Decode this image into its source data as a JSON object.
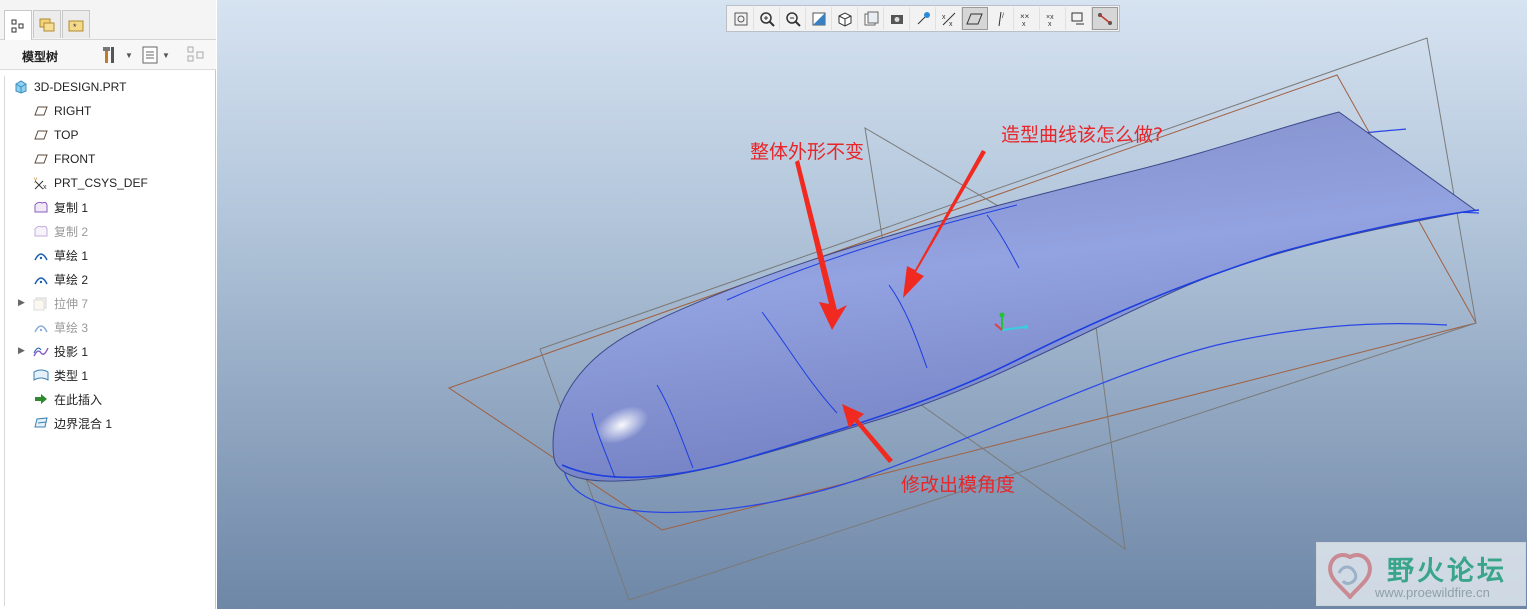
{
  "panel": {
    "title": "模型树",
    "tabs": [
      {
        "name": "model-tree-tab",
        "icon": "model-tree-icon"
      },
      {
        "name": "layers-tab",
        "icon": "folder-stack-icon"
      },
      {
        "name": "favorites-tab",
        "icon": "star-folder-icon"
      }
    ]
  },
  "tree": {
    "root": "3D-DESIGN.PRT",
    "items": [
      {
        "label": "RIGHT",
        "icon": "datum-plane-icon",
        "dim": false
      },
      {
        "label": "TOP",
        "icon": "datum-plane-icon",
        "dim": false
      },
      {
        "label": "FRONT",
        "icon": "datum-plane-icon",
        "dim": false
      },
      {
        "label": "PRT_CSYS_DEF",
        "icon": "coordinate-system-icon",
        "dim": false
      },
      {
        "label": "复制 1",
        "icon": "copy-surface-icon",
        "dim": false
      },
      {
        "label": "复制 2",
        "icon": "copy-surface-icon",
        "dim": true
      },
      {
        "label": "草绘 1",
        "icon": "sketch-icon",
        "dim": false
      },
      {
        "label": "草绘 2",
        "icon": "sketch-icon",
        "dim": false
      },
      {
        "label": "拉伸 7",
        "icon": "extrude-icon",
        "dim": true
      },
      {
        "label": "草绘 3",
        "icon": "sketch-icon",
        "dim": true
      },
      {
        "label": "投影 1",
        "icon": "projection-icon",
        "dim": false
      },
      {
        "label": "类型 1",
        "icon": "style-surface-icon",
        "dim": false
      },
      {
        "label": "在此插入",
        "icon": "insert-here-arrow-icon",
        "dim": false
      },
      {
        "label": "边界混合 1",
        "icon": "boundary-blend-icon",
        "dim": false
      }
    ]
  },
  "toolbar": {
    "buttons": [
      "refit-icon",
      "zoom-in-icon",
      "zoom-out-icon",
      "repaint-icon",
      "saved-orientations-icon",
      "display-style-icon",
      "named-views-icon",
      "spin-center-icon",
      "datum-display-filter-icon",
      "plane-display-icon",
      "axis-display-icon",
      "point-display-icon",
      "csys-display-icon",
      "annotation-display-icon",
      "sketch-display-icon"
    ]
  },
  "annotations": {
    "note_1": "整体外形不变",
    "note_2": "造型曲线该怎么做?",
    "note_3": "修改出模角度"
  },
  "watermark": {
    "cn": "野火论坛",
    "url": "www.proewildfire.cn"
  },
  "colors": {
    "annotation": "#e8262a",
    "surface": "#8a99d6",
    "curve": "#1d3fe0",
    "datum_plane_front": "#a06040",
    "datum_plane_side": "#7a7a7a"
  }
}
